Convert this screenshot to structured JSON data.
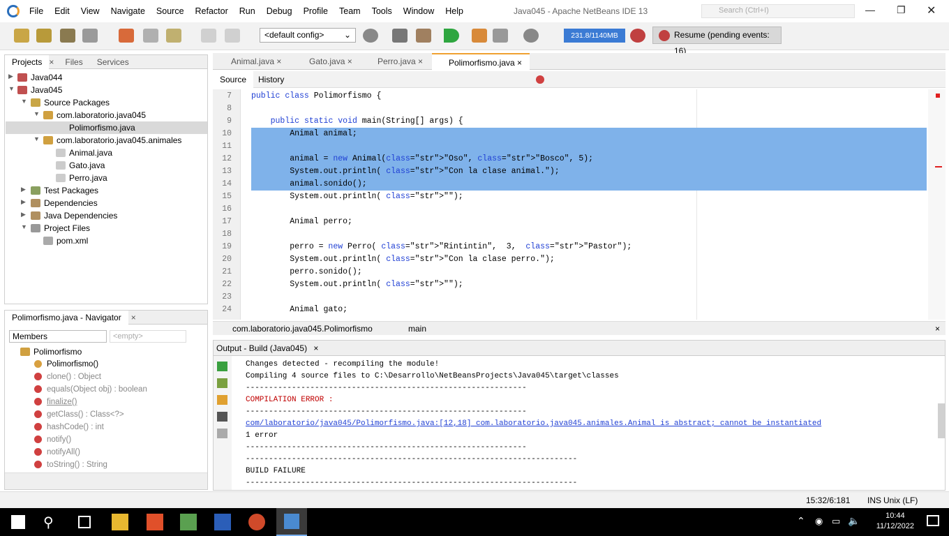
{
  "window": {
    "title": "Java045 - Apache NetBeans IDE 13",
    "search_placeholder": "Search (Ctrl+I)",
    "menu": [
      "File",
      "Edit",
      "View",
      "Navigate",
      "Source",
      "Refactor",
      "Run",
      "Debug",
      "Profile",
      "Team",
      "Tools",
      "Window",
      "Help"
    ]
  },
  "toolbar": {
    "config": "<default config>",
    "memory": "231.8/1140MB",
    "resume": "Resume (pending events: 16)"
  },
  "projects": {
    "tabs": [
      "Projects",
      "Files",
      "Services"
    ],
    "tree": [
      {
        "label": "Java044",
        "icon": "project-icon"
      },
      {
        "label": "Java045",
        "icon": "project-icon"
      },
      {
        "label": "Source Packages",
        "icon": "source-packages-icon"
      },
      {
        "label": "com.laboratorio.java045",
        "icon": "package-icon"
      },
      {
        "label": "Polimorfismo.java",
        "icon": "java-file-icon"
      },
      {
        "label": "com.laboratorio.java045.animales",
        "icon": "package-icon"
      },
      {
        "label": "Animal.java",
        "icon": "java-file-icon"
      },
      {
        "label": "Gato.java",
        "icon": "java-file-icon"
      },
      {
        "label": "Perro.java",
        "icon": "java-file-icon"
      },
      {
        "label": "Test Packages",
        "icon": "test-packages-icon"
      },
      {
        "label": "Dependencies",
        "icon": "dependencies-icon"
      },
      {
        "label": "Java Dependencies",
        "icon": "java-dependencies-icon"
      },
      {
        "label": "Project Files",
        "icon": "project-files-icon"
      },
      {
        "label": "pom.xml",
        "icon": "xml-file-icon"
      }
    ]
  },
  "navigator": {
    "title": "Polimorfismo.java - Navigator",
    "filter": "Members",
    "empty": "<empty>",
    "root": "Polimorfismo",
    "members": [
      "Polimorfismo()",
      "clone() : Object",
      "equals(Object obj) : boolean",
      "finalize()",
      "getClass() : Class<?>",
      "hashCode() : int",
      "notify()",
      "notifyAll()",
      "toString() : String"
    ]
  },
  "editor": {
    "tabs": [
      "Animal.java",
      "Gato.java",
      "Perro.java",
      "Polimorfismo.java"
    ],
    "source_tab": "Source",
    "history_tab": "History",
    "lines": [
      {
        "n": "7",
        "code": "public class Polimorfismo {"
      },
      {
        "n": "8",
        "code": ""
      },
      {
        "n": "9",
        "code": "    public static void main(String[] args) {"
      },
      {
        "n": "10",
        "code": "        Animal animal;"
      },
      {
        "n": "11",
        "code": ""
      },
      {
        "n": "12",
        "code": "        animal = new Animal(\"Oso\", \"Bosco\", 5);"
      },
      {
        "n": "13",
        "code": "        System.out.println( \"Con la clase animal.\");"
      },
      {
        "n": "14",
        "code": "        animal.sonido();"
      },
      {
        "n": "15",
        "code": "        System.out.println( \"\");"
      },
      {
        "n": "16",
        "code": ""
      },
      {
        "n": "17",
        "code": "        Animal perro;"
      },
      {
        "n": "18",
        "code": ""
      },
      {
        "n": "19",
        "code": "        perro = new Perro( \"Rintintin\",  3,  \"Pastor\");"
      },
      {
        "n": "20",
        "code": "        System.out.println( \"Con la clase perro.\");"
      },
      {
        "n": "21",
        "code": "        perro.sonido();"
      },
      {
        "n": "22",
        "code": "        System.out.println( \"\");"
      },
      {
        "n": "23",
        "code": ""
      },
      {
        "n": "24",
        "code": "        Animal gato;"
      }
    ],
    "breadcrumb": [
      "com.laboratorio.java045.Polimorfismo",
      "main"
    ]
  },
  "output": {
    "title": "Output - Build (Java045)",
    "lines": [
      "Changes detected - recompiling the module!",
      "Compiling 4 source files to C:\\Desarrollo\\NetBeansProjects\\Java045\\target\\classes",
      "-------------------------------------------------------------",
      "COMPILATION ERROR :",
      "-------------------------------------------------------------",
      "com/laboratorio/java045/Polimorfismo.java:[12,18] com.laboratorio.java045.animales.Animal is abstract; cannot be instantiated",
      "1 error",
      "-------------------------------------------------------------",
      "------------------------------------------------------------------------",
      "BUILD FAILURE",
      "------------------------------------------------------------------------"
    ]
  },
  "status": {
    "position": "15:32/6:181",
    "mode": "INS",
    "eol": "Unix (LF)"
  },
  "taskbar": {
    "time": "10:44",
    "date": "11/12/2022"
  },
  "colors": {
    "selection": "#7fb2ea",
    "keyword": "#1f3fd4",
    "string": "#c47a1e",
    "error": "#c00000",
    "accent": "#f0a030"
  }
}
